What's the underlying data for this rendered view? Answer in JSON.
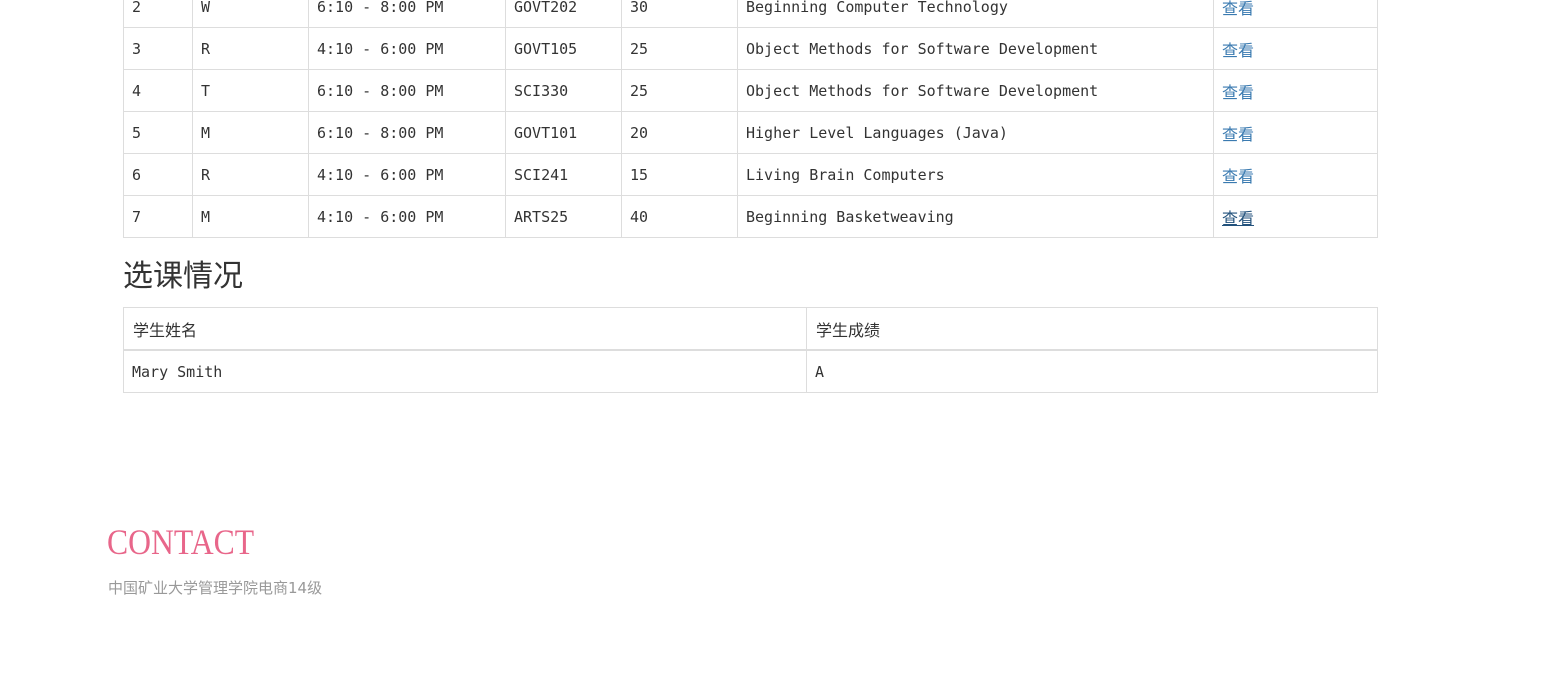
{
  "courses": [
    {
      "num": "2",
      "day": "W",
      "time": "6:10 - 8:00 PM",
      "room": "GOVT202",
      "cap": "30",
      "title": "Beginning Computer Technology",
      "action": "查看"
    },
    {
      "num": "3",
      "day": "R",
      "time": "4:10 - 6:00 PM",
      "room": "GOVT105",
      "cap": "25",
      "title": "Object Methods for Software Development",
      "action": "查看"
    },
    {
      "num": "4",
      "day": "T",
      "time": "6:10 - 8:00 PM",
      "room": "SCI330",
      "cap": "25",
      "title": "Object Methods for Software Development",
      "action": "查看"
    },
    {
      "num": "5",
      "day": "M",
      "time": "6:10 - 8:00 PM",
      "room": "GOVT101",
      "cap": "20",
      "title": "Higher Level Languages (Java)",
      "action": "查看"
    },
    {
      "num": "6",
      "day": "R",
      "time": "4:10 - 6:00 PM",
      "room": "SCI241",
      "cap": "15",
      "title": "Living Brain Computers",
      "action": "查看"
    },
    {
      "num": "7",
      "day": "M",
      "time": "4:10 - 6:00 PM",
      "room": "ARTS25",
      "cap": "40",
      "title": "Beginning Basketweaving",
      "action": "查看"
    }
  ],
  "enrollment": {
    "title": "选课情况",
    "headers": {
      "student_name": "学生姓名",
      "student_grade": "学生成绩"
    },
    "rows": [
      {
        "name": "Mary Smith",
        "grade": "A"
      }
    ]
  },
  "footer": {
    "contact_title": "CONTACT",
    "contact_text": "中国矿业大学管理学院电商14级"
  },
  "colors": {
    "link": "#3a7ab0",
    "link_active": "#23527c",
    "contact_accent": "#e8668a",
    "border": "#dddddd"
  }
}
